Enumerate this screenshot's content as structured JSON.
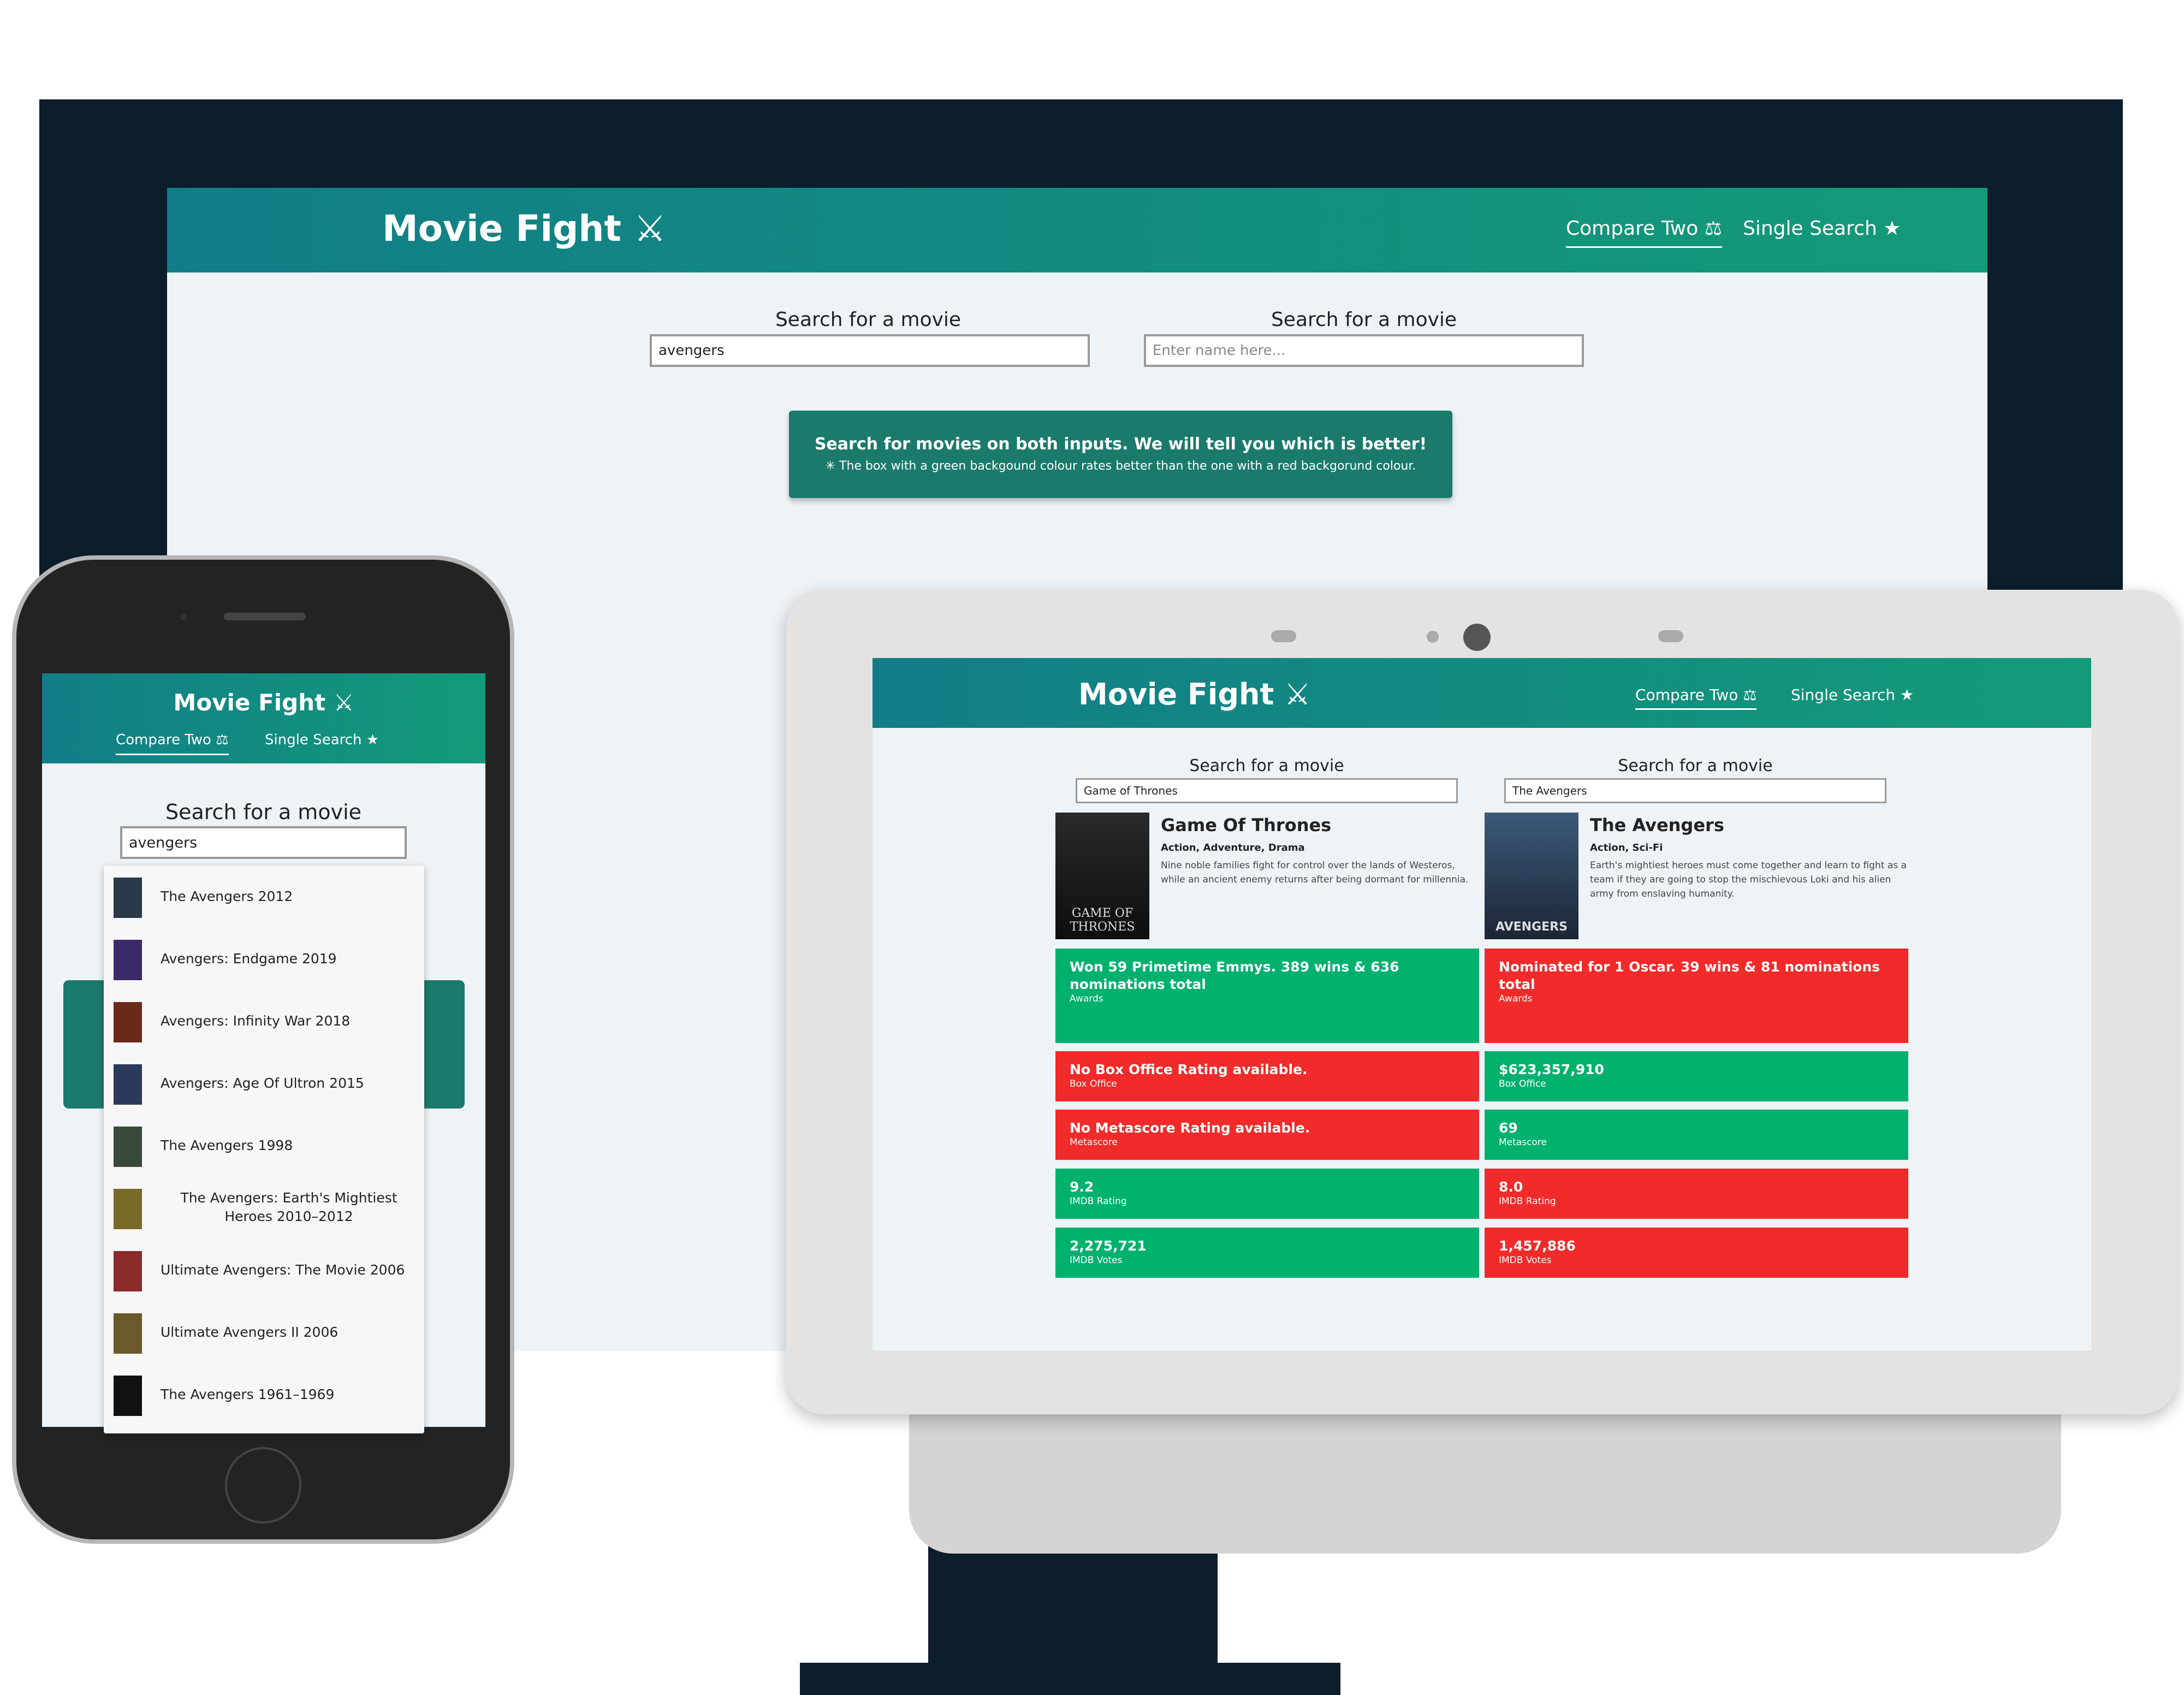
{
  "app": {
    "logo": "Movie Fight ⚔",
    "nav": [
      {
        "label": "Compare Two ⚖",
        "active": true
      },
      {
        "label": "Single Search ★",
        "active": false
      }
    ]
  },
  "monitor": {
    "left_search": {
      "label": "Search for a movie",
      "value": "avengers"
    },
    "right_search": {
      "label": "Search for a movie",
      "placeholder": "Enter name here..."
    },
    "notice": {
      "title": "Search for movies on both inputs. We will tell you which is better!",
      "subtitle": "✳ The box with a green backgound colour rates better than the one with a red backgorund colour."
    }
  },
  "tablet": {
    "left": {
      "search_label": "Search for a movie",
      "search_value": "Game of Thrones",
      "poster_text": "GAME OF THRONES",
      "title": "Game Of Thrones",
      "genre": "Action, Adventure, Drama",
      "plot": "Nine noble families fight for control over the lands of Westeros, while an ancient enemy returns after being dormant for millennia.",
      "stats": [
        {
          "value": "Won 59 Primetime Emmys. 389 wins & 636 nominations total",
          "label": "Awards",
          "result": "win"
        },
        {
          "value": "No Box Office Rating available.",
          "label": "Box Office",
          "result": "lose"
        },
        {
          "value": "No Metascore Rating available.",
          "label": "Metascore",
          "result": "lose"
        },
        {
          "value": "9.2",
          "label": "IMDB Rating",
          "result": "win"
        },
        {
          "value": "2,275,721",
          "label": "IMDB Votes",
          "result": "win"
        }
      ]
    },
    "right": {
      "search_label": "Search for a movie",
      "search_value": "The Avengers",
      "poster_text": "AVENGERS",
      "title": "The Avengers",
      "genre": "Action, Sci-Fi",
      "plot": "Earth's mightiest heroes must come together and learn to fight as a team if they are going to stop the mischievous Loki and his alien army from enslaving humanity.",
      "stats": [
        {
          "value": "Nominated for 1 Oscar. 39 wins & 81 nominations total",
          "label": "Awards",
          "result": "lose"
        },
        {
          "value": "$623,357,910",
          "label": "Box Office",
          "result": "win"
        },
        {
          "value": "69",
          "label": "Metascore",
          "result": "win"
        },
        {
          "value": "8.0",
          "label": "IMDB Rating",
          "result": "lose"
        },
        {
          "value": "1,457,886",
          "label": "IMDB Votes",
          "result": "lose"
        }
      ]
    }
  },
  "phone": {
    "search_label": "Search for a movie",
    "search_value": "avengers",
    "results": [
      {
        "text": "The Avengers 2012",
        "color": "#2b3a4a"
      },
      {
        "text": "Avengers: Endgame 2019",
        "color": "#3a2a6a"
      },
      {
        "text": "Avengers: Infinity War 2018",
        "color": "#6a2a1a"
      },
      {
        "text": "Avengers: Age Of Ultron 2015",
        "color": "#2a3a5a"
      },
      {
        "text": "The Avengers 1998",
        "color": "#3a4a3a"
      },
      {
        "text": "The Avengers: Earth's Mightiest Heroes 2010–2012",
        "color": "#7a6a2a"
      },
      {
        "text": "Ultimate Avengers: The Movie 2006",
        "color": "#8a2a2a"
      },
      {
        "text": "Ultimate Avengers II 2006",
        "color": "#6a5a2a"
      },
      {
        "text": "The Avengers 1961–1969",
        "color": "#111111"
      }
    ]
  },
  "colors": {
    "header_start": "#127d88",
    "header_end": "#139a78",
    "win": "#00b16e",
    "lose": "#f12a2a",
    "notice": "#1a7a6b",
    "monitor": "#0c1d2b"
  }
}
